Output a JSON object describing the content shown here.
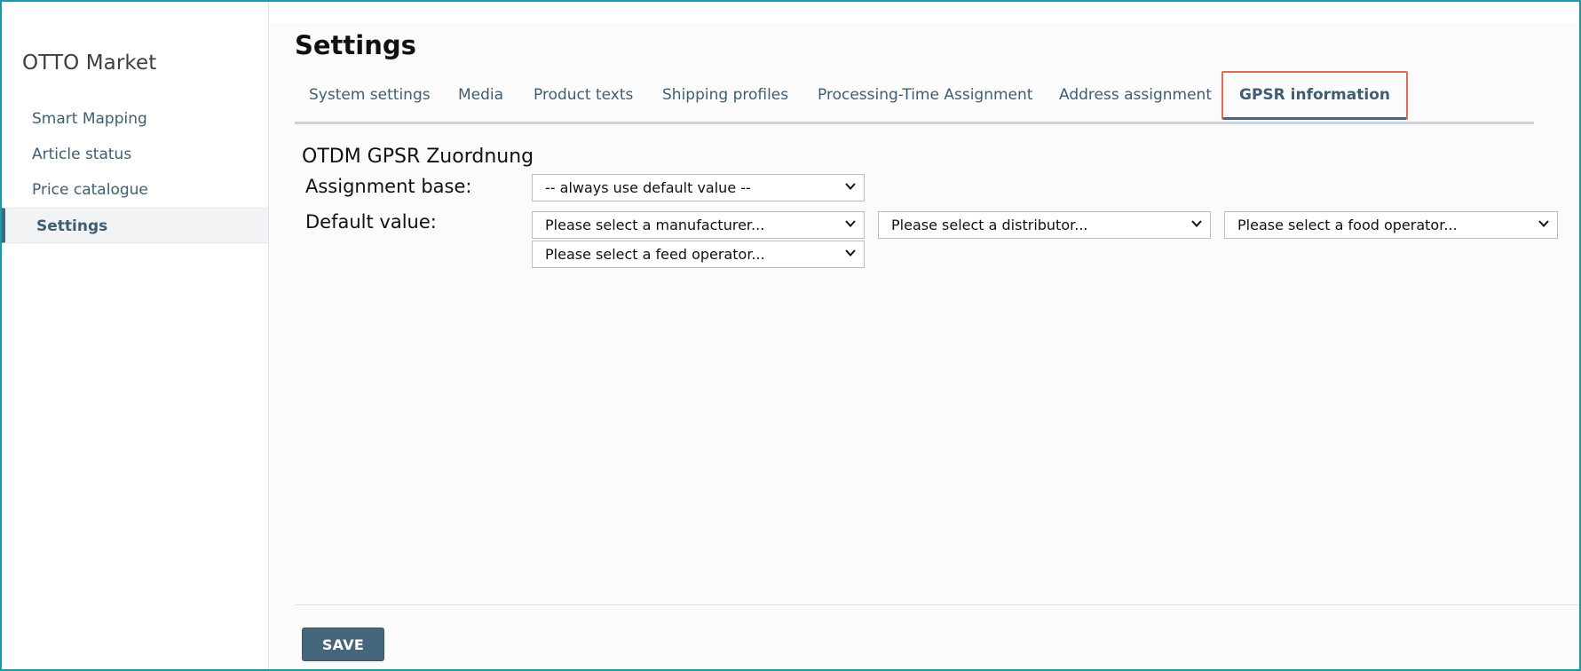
{
  "sidebar": {
    "app_title": "OTTO Market",
    "items": [
      {
        "label": "Smart Mapping"
      },
      {
        "label": "Article status"
      },
      {
        "label": "Price catalogue"
      },
      {
        "label": "Settings",
        "active": true
      }
    ]
  },
  "header": {
    "title": "Settings"
  },
  "tabs": [
    {
      "label": "System settings"
    },
    {
      "label": "Media"
    },
    {
      "label": "Product texts"
    },
    {
      "label": "Shipping profiles"
    },
    {
      "label": "Processing-Time Assignment"
    },
    {
      "label": "Address assignment"
    },
    {
      "label": "GPSR information",
      "active": true
    }
  ],
  "form": {
    "section_title": "OTDM GPSR Zuordnung",
    "assignment_base": {
      "label": "Assignment base:",
      "value": "-- always use default value --"
    },
    "default_value": {
      "label": "Default value:",
      "manufacturer": "Please select a manufacturer...",
      "distributor": "Please select a distributor...",
      "food_operator": "Please select a food operator...",
      "feed_operator": "Please select a feed operator..."
    }
  },
  "footer": {
    "save_label": "SAVE"
  },
  "colors": {
    "accent": "#46677b",
    "highlight_border": "#e06a5d",
    "link": "#3f5e73"
  },
  "icons": {
    "dropdown": "chevron-down-icon"
  }
}
